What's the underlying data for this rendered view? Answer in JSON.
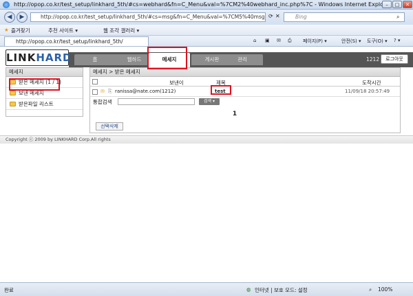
{
  "window": {
    "title": "http://opop.co.kr/test_setup/linkhard_5th/#cs=webhard&fn=C_Menu&val=%7CM2%40webhard_inc.php%7C - Windows Internet Explorer",
    "minimize": "–",
    "maximize": "□",
    "close": "✕"
  },
  "browser": {
    "address": "http://opop.co.kr/test_setup/linkhard_5th/#cs=msg&fn=C_Menu&val=%7CM5%40msg_inc.php%7C",
    "search_placeholder": "Bing",
    "favorites_label": "즐겨찾기",
    "suggested_sites": "추천 사이트 ▾",
    "web_slice_gallery": "웹 조각 갤러리 ▾",
    "tab_title": "http://opop.co.kr/test_setup/linkhard_5th/",
    "tools": [
      "페이지(P) ▾",
      "안전(S) ▾",
      "도구(O) ▾",
      "? ▾"
    ],
    "status_left": "완료",
    "status_zone": "인터넷 | 보호 모드: 설정",
    "zoom": "100%"
  },
  "site": {
    "logo_link": "LINK",
    "logo_hard": "HARD",
    "nav": [
      "홈",
      "웹하드",
      "메세지",
      "게시판",
      "관리"
    ],
    "active_nav_index": 2,
    "user_code": "1212",
    "logout_label": "로그아웃"
  },
  "sidebar": {
    "header": "메세지",
    "items": [
      {
        "label": "받은 메세지",
        "count": "(1 / 1)"
      },
      {
        "label": "보낸 메세지",
        "count": ""
      },
      {
        "label": "받은파일 리스트",
        "count": ""
      }
    ]
  },
  "main": {
    "breadcrumb": "메세지 > 받은 메세지",
    "columns": {
      "sender": "보낸이",
      "title": "제목",
      "arrival": "도착시간"
    },
    "rows": [
      {
        "sender": "ranissa@nate.com(1212)",
        "title": "test",
        "arrival": "11/09/18 20:57:49"
      }
    ],
    "search_label": "통합검색",
    "search_button": "검색 ▾",
    "page": "1",
    "delete_button": "선택삭제"
  },
  "footer": {
    "copyright": "Copyright ⓒ 2009 by LINKHARD Corp.All rights"
  }
}
